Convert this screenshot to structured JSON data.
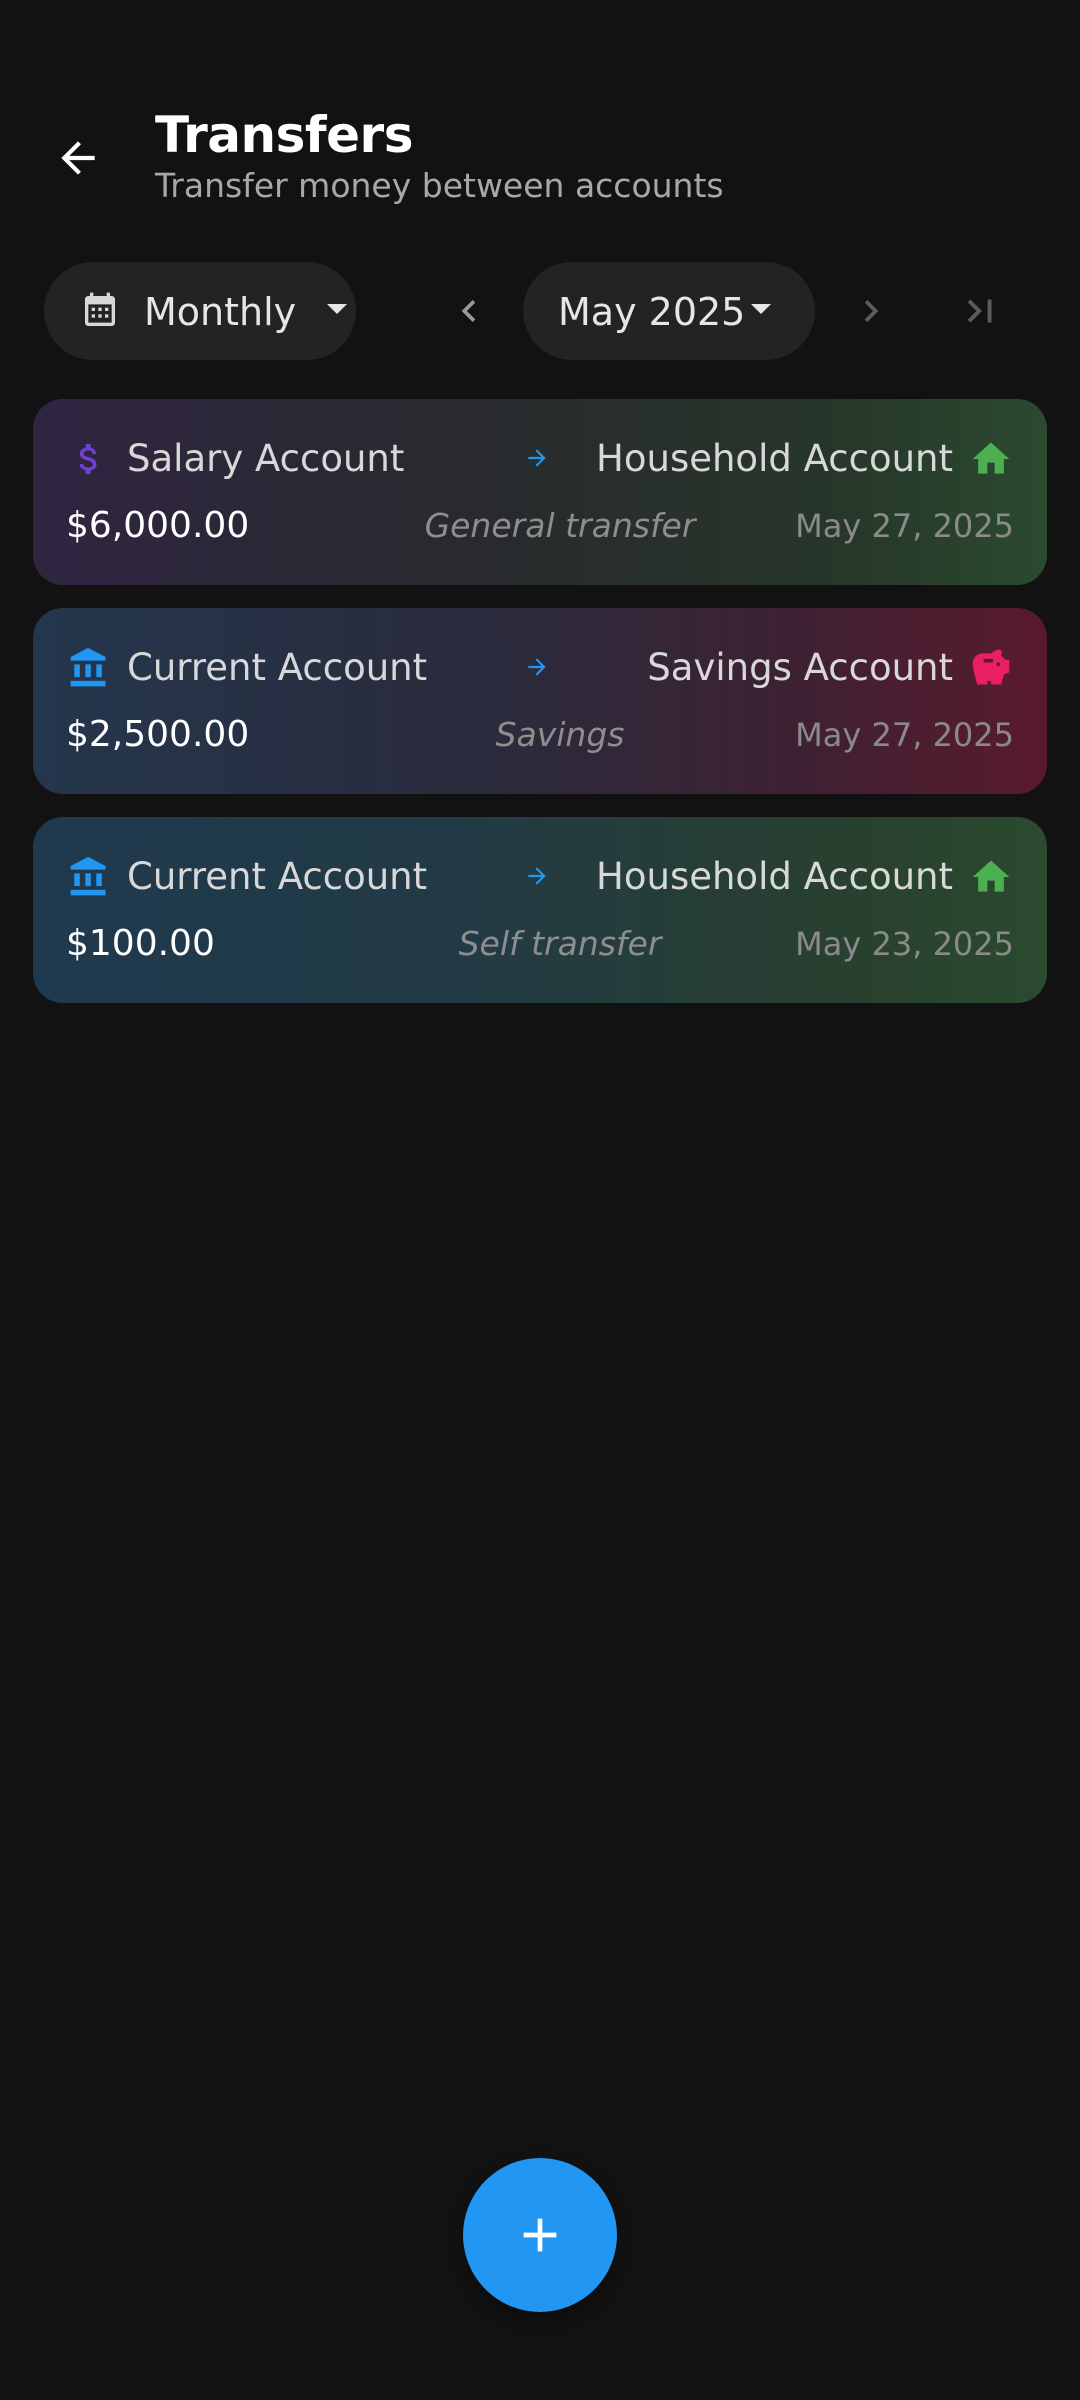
{
  "header": {
    "title": "Transfers",
    "subtitle": "Transfer money between accounts",
    "back_icon": "arrow-left-icon"
  },
  "filters": {
    "period": {
      "label": "Monthly",
      "icon": "calendar-icon"
    },
    "month": {
      "label": "May 2025"
    },
    "prev_icon": "chevron-left-icon",
    "next_icon": "chevron-right-icon",
    "last_icon": "skip-to-end-icon"
  },
  "transfers": [
    {
      "from_account": "Salary Account",
      "from_icon": "dollar-icon",
      "to_account": "Household Account",
      "to_icon": "home-icon",
      "amount": "$6,000.00",
      "note": "General transfer",
      "date": "May 27, 2025"
    },
    {
      "from_account": "Current Account",
      "from_icon": "bank-icon",
      "to_account": "Savings Account",
      "to_icon": "piggy-bank-icon",
      "amount": "$2,500.00",
      "note": "Savings",
      "date": "May 27, 2025"
    },
    {
      "from_account": "Current Account",
      "from_icon": "bank-icon",
      "to_account": "Household Account",
      "to_icon": "home-icon",
      "amount": "$100.00",
      "note": "Self transfer",
      "date": "May 23, 2025"
    }
  ],
  "fab": {
    "icon": "plus-icon"
  },
  "colors": {
    "background": "#121212",
    "accent": "#2196f3",
    "dollar": "#6f3fd6",
    "bank": "#2196f3",
    "home": "#4caf50",
    "piggy": "#e91e63"
  }
}
